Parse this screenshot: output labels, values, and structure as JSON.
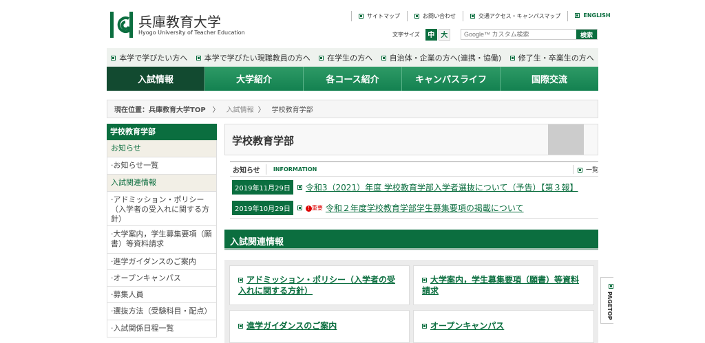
{
  "logo": {
    "name": "兵庫教育大学",
    "sub": "Hyogo University of Teacher Education"
  },
  "toplinks": [
    "サイトマップ",
    "お問い合わせ",
    "交通アクセス・キャンパスマップ",
    "ENGLISH"
  ],
  "fontsize": {
    "label": "文字サイズ",
    "mid": "中",
    "large": "大"
  },
  "search": {
    "placeholder": "Google™ カスタム検索",
    "button": "検索"
  },
  "audience": [
    "本学で学びたい方へ",
    "本学で学びたい現職教員の方へ",
    "在学生の方へ",
    "自治体・企業の方へ(連携・協働)",
    "修了生・卒業生の方へ"
  ],
  "gnav": [
    "入試情報",
    "大学紹介",
    "各コース紹介",
    "キャンパスライフ",
    "国際交流"
  ],
  "breadcrumb": {
    "label": "現在位置：",
    "items": [
      "兵庫教育大学TOP",
      "入試情報",
      "学校教育学部"
    ]
  },
  "sidebar": {
    "heading": "学校教育学部",
    "cat1": "お知らせ",
    "cat1_items": [
      "お知らせ一覧"
    ],
    "cat2": "入試関連情報",
    "cat2_items": [
      "アドミッション・ポリシー（入学者の受入れに関する方針）",
      "大学案内，学生募集要項（願書）等資料請求",
      "進学ガイダンスのご案内",
      "オープンキャンパス",
      "募集人員",
      "選抜方法（受験科目・配点）",
      "入試関係日程一覧"
    ]
  },
  "title": "学校教育学部",
  "info": {
    "label": "お知らせ",
    "en": "INFORMATION",
    "all": "一覧"
  },
  "news": [
    {
      "date": "2019年11月29日",
      "title": "令和3（2021）年度 学校教育学部入学者選抜について（予告）【第３報】"
    },
    {
      "date": "2019年10月29日",
      "badge": "重要",
      "title": "令和２年度学校教育学部学生募集要項の掲載について"
    }
  ],
  "section": "入試関連情報",
  "cards": [
    "アドミッション・ポリシー（入学者の受入れに関する方針）",
    "大学案内，学生募集要項（願書）等資料請求",
    "進学ガイダンスのご案内",
    "オープンキャンパス"
  ],
  "pagetop": "PAGETOP"
}
